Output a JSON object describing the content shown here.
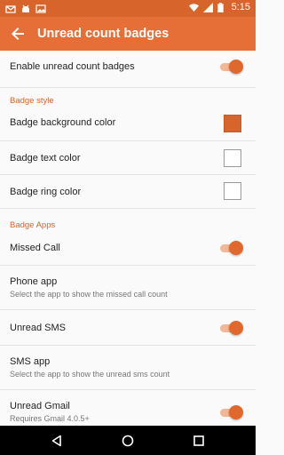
{
  "statusbar": {
    "time": "5:15"
  },
  "appbar": {
    "title": "Unread count badges"
  },
  "settings": {
    "enable": {
      "label": "Enable unread count badges",
      "checked": true
    },
    "badge_style_header": "Badge style",
    "bg_color": {
      "label": "Badge background color",
      "color": "#d7642a"
    },
    "text_color": {
      "label": "Badge text color",
      "color": "#ffffff"
    },
    "ring_color": {
      "label": "Badge ring color",
      "color": "#ffffff"
    },
    "badge_apps_header": "Badge Apps",
    "missed_call": {
      "label": "Missed Call",
      "checked": true
    },
    "phone_app": {
      "label": "Phone app",
      "summary": "Select the app to show the missed call count"
    },
    "unread_sms": {
      "label": "Unread SMS",
      "checked": true
    },
    "sms_app": {
      "label": "SMS app",
      "summary": "Select the app to show the unread sms count"
    },
    "unread_gmail": {
      "label": "Unread Gmail",
      "summary": "Requires Gmail 4.0.5+",
      "checked": true
    }
  },
  "colors": {
    "statusbar": "#d7642a",
    "appbar": "#e56f36",
    "accent": "#e0682c"
  }
}
